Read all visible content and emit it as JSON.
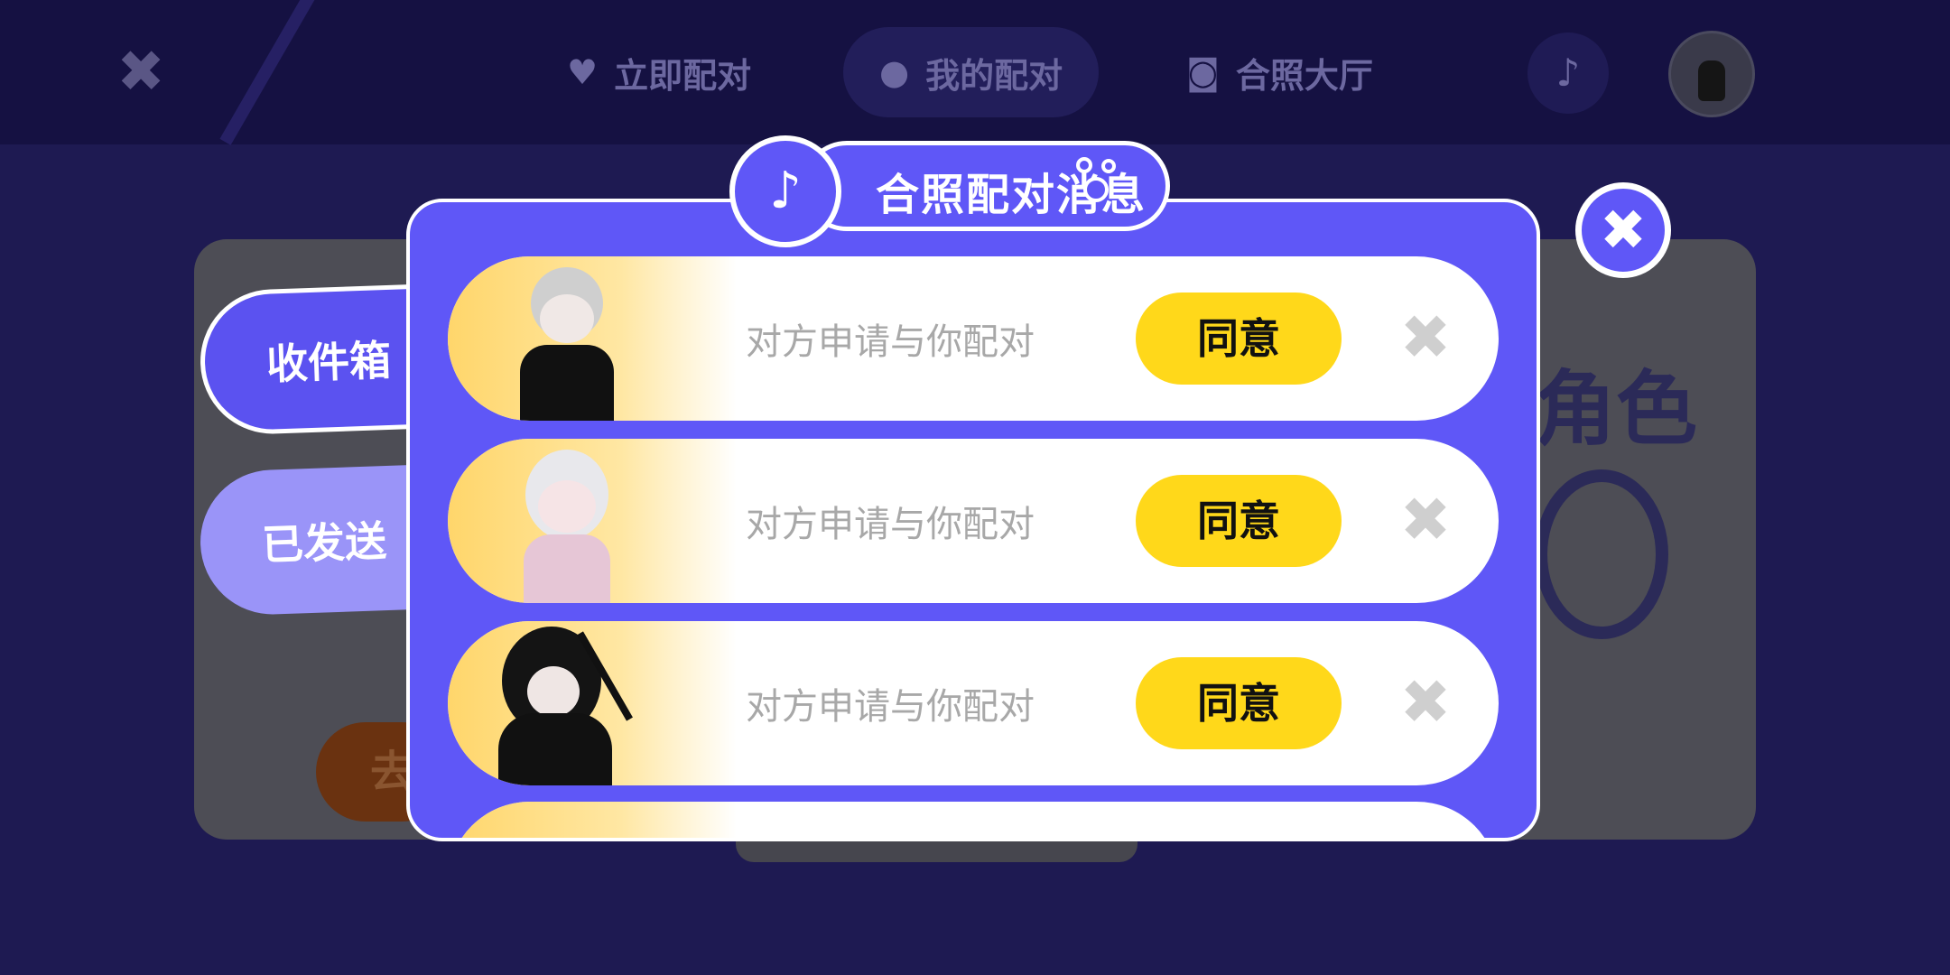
{
  "topnav": {
    "close_glyph": "✖",
    "tabs": [
      {
        "label": "立即配对",
        "icon": "hearts-icon"
      },
      {
        "label": "我的配对",
        "icon": "person-icon"
      },
      {
        "label": "合照大厅",
        "icon": "camera-icon"
      }
    ]
  },
  "side_tabs": {
    "inbox": "收件箱",
    "sent": "已发送"
  },
  "background": {
    "role_text": "角色",
    "go_text": "去"
  },
  "modal": {
    "title": "合照配对消息",
    "close_glyph": "✖",
    "requests": [
      {
        "message": "对方申请与你配对",
        "agree": "同意",
        "reject": "✖"
      },
      {
        "message": "对方申请与你配对",
        "agree": "同意",
        "reject": "✖"
      },
      {
        "message": "对方申请与你配对",
        "agree": "同意",
        "reject": "✖"
      }
    ]
  },
  "colors": {
    "primary": "#5f57f7",
    "agree_button": "#ffd81a",
    "nav_bg": "#151142",
    "page_bg": "#1e1a52"
  }
}
